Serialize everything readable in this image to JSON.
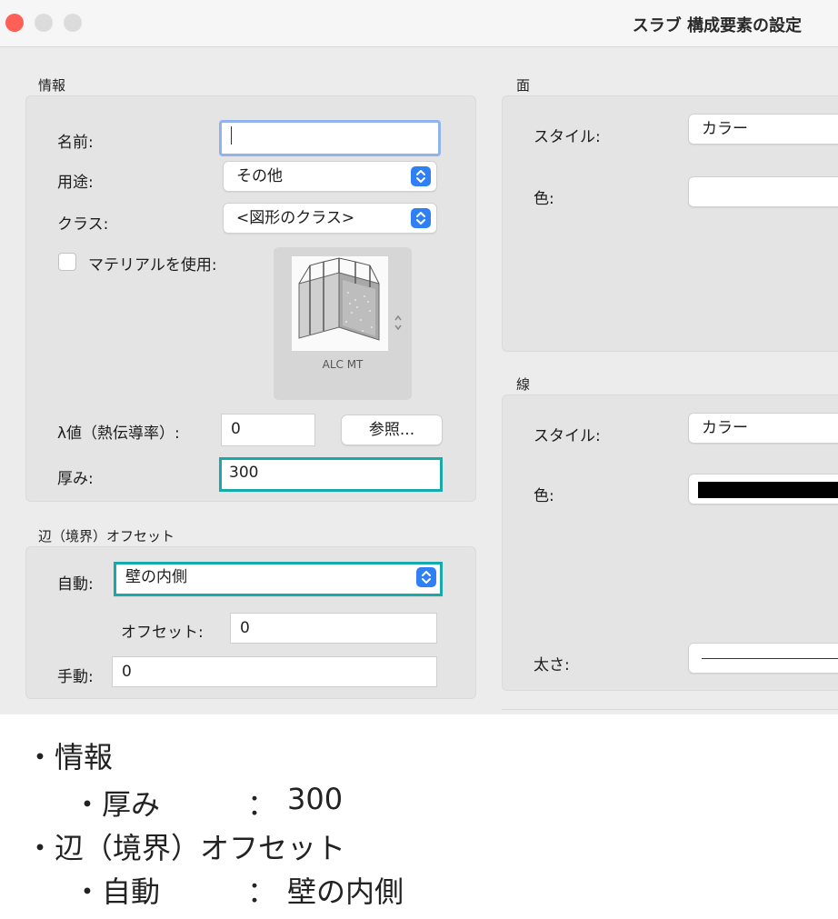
{
  "window": {
    "title": "スラブ 構成要素の設定",
    "colors": {
      "close": "#fe5f57",
      "inactive": "#dcdcdc",
      "highlight": "#1aa9a9",
      "stepper": "#2f7ff5"
    }
  },
  "info": {
    "section_title": "情報",
    "name_label": "名前:",
    "name_value": "",
    "use_label": "用途:",
    "use_value": "その他",
    "class_label": "クラス:",
    "class_value": "<図形のクラス>",
    "material_label": "マテリアルを使用:",
    "material_checked": false,
    "material_name": "ALC MT",
    "lambda_label": "λ値（熱伝導率）:",
    "lambda_value": "0",
    "browse_label": "参照...",
    "thickness_label": "厚み:",
    "thickness_value": "300"
  },
  "offset": {
    "section_title": "辺（境界）オフセット",
    "auto_label": "自動:",
    "auto_value": "壁の内側",
    "offset_label": "オフセット:",
    "offset_value": "0",
    "manual_label": "手動:",
    "manual_value": "0"
  },
  "face": {
    "section_title": "面",
    "style_label": "スタイル:",
    "style_value": "カラー",
    "color_label": "色:"
  },
  "line": {
    "section_title": "線",
    "style_label": "スタイル:",
    "style_value": "カラー",
    "color_label": "色:",
    "color_value": "#000000",
    "weight_label": "太さ:"
  },
  "notes": {
    "l1": "・情報",
    "l2": "・厚み",
    "l2_colon": "：",
    "l2_value": "300",
    "l3": "・辺（境界）オフセット",
    "l4": "・自動",
    "l4_colon": "：",
    "l4_value": "壁の内側"
  }
}
